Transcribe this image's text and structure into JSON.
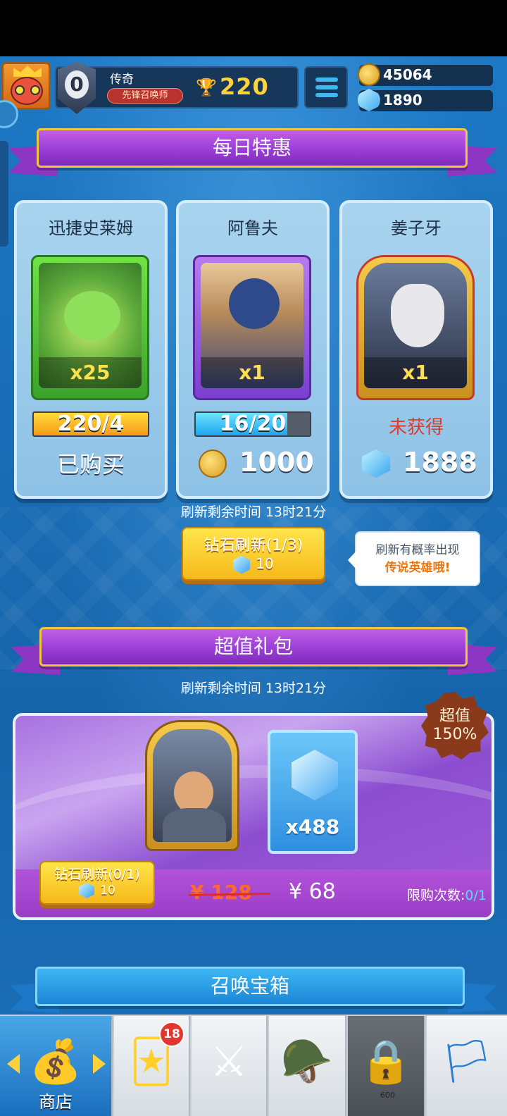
{
  "header": {
    "player_name": "传奇",
    "player_title": "先锋召唤师",
    "rank_level": "0",
    "trophies": "220",
    "gold": "45064",
    "gems": "1890"
  },
  "daily_deals": {
    "title": "每日特惠",
    "cards": [
      {
        "name": "迅捷史莱姆",
        "count": "x25",
        "progress": "220/4",
        "progress_fill": 1.0,
        "status": "已购买"
      },
      {
        "name": "阿鲁夫",
        "count": "x1",
        "progress": "16/20",
        "progress_fill": 0.8,
        "price": "1000",
        "currency": "gold"
      },
      {
        "name": "姜子牙",
        "count": "x1",
        "status": "未获得",
        "price": "1888",
        "currency": "gem"
      }
    ],
    "refresh_time": "刷新剩余时间 13时21分",
    "refresh_button": {
      "label": "钻石刷新(1/3)",
      "cost": "10"
    },
    "tip": {
      "line1": "刷新有概率出现",
      "line2": "传说英雄哦!"
    }
  },
  "value_pack": {
    "title": "超值礼包",
    "refresh_time": "刷新剩余时间 13时21分",
    "badge_line1": "超值",
    "badge_line2": "150%",
    "gem_amount": "x488",
    "refresh_button": {
      "label": "钻石刷新(0/1)",
      "cost": "10"
    },
    "old_price": "¥ 128",
    "new_price": "¥ 68",
    "limit_label": "限购次数:",
    "limit_value": "0/1"
  },
  "summon": {
    "title": "召唤宝箱"
  },
  "nav": {
    "shop_label": "商店",
    "cards_badge": "18",
    "lock_value": "600"
  },
  "colors": {
    "accent_gold": "#ffd23c",
    "ribbon_purple": "#9a3ed6",
    "background_blue": "#1d6fb8",
    "unowned_red": "#e23a2a"
  }
}
